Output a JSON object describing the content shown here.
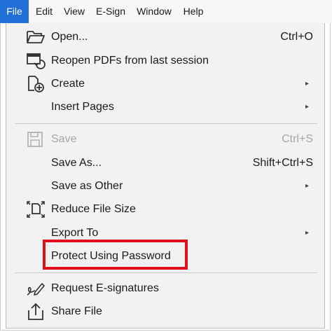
{
  "menubar": {
    "items": [
      {
        "label": "File"
      },
      {
        "label": "Edit"
      },
      {
        "label": "View"
      },
      {
        "label": "E-Sign"
      },
      {
        "label": "Window"
      },
      {
        "label": "Help"
      }
    ]
  },
  "menu": {
    "items": [
      {
        "label": "Open...",
        "shortcut": "Ctrl+O",
        "icon": "folder-open-icon"
      },
      {
        "label": "Reopen PDFs from last session",
        "icon": "reopen-icon"
      },
      {
        "label": "Create",
        "icon": "create-pdf-icon"
      },
      {
        "label": "Insert Pages"
      },
      {
        "label": "Save",
        "shortcut": "Ctrl+S",
        "icon": "save-icon",
        "disabled": true
      },
      {
        "label": "Save As...",
        "shortcut": "Shift+Ctrl+S"
      },
      {
        "label": "Save as Other"
      },
      {
        "label": "Reduce File Size",
        "icon": "reduce-size-icon"
      },
      {
        "label": "Export To"
      },
      {
        "label": "Protect Using Password"
      },
      {
        "label": "Request E-signatures",
        "icon": "signature-icon"
      },
      {
        "label": "Share File",
        "icon": "share-icon"
      }
    ],
    "submenu_arrow": "▸"
  },
  "colors": {
    "accent": "#1f6fd6",
    "highlight_border": "#e0101a"
  }
}
